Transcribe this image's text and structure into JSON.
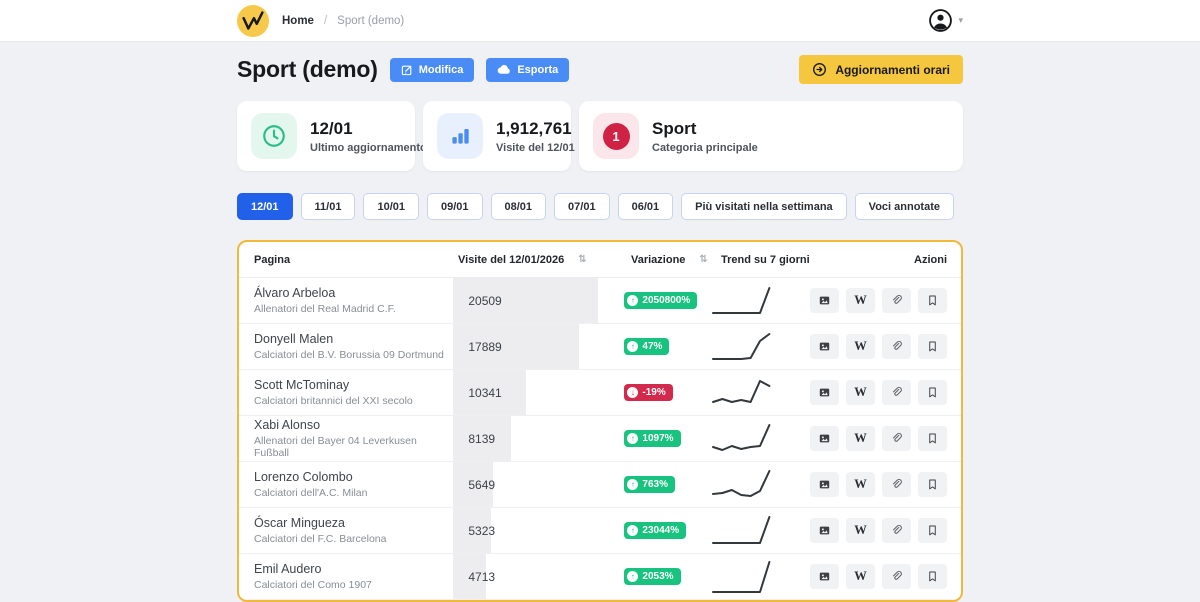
{
  "topbar": {
    "breadcrumb": {
      "home": "Home",
      "separator": "/",
      "current": "Sport (demo)"
    }
  },
  "header": {
    "title": "Sport (demo)",
    "edit_label": "Modifica",
    "export_label": "Esporta",
    "hourly_label": "Aggiornamenti orari"
  },
  "stat_cards": [
    {
      "id": "last-update",
      "value": "12/01",
      "label": "Ultimo aggiornamento",
      "icon": "clock-icon"
    },
    {
      "id": "daily-visits",
      "value": "1,912,761",
      "label": "Visite del 12/01",
      "icon": "bar-chart-icon"
    },
    {
      "id": "main-category",
      "value": "Sport",
      "label": "Categoria principale",
      "icon": "rank-1-badge",
      "badge_text": "1"
    }
  ],
  "filters": {
    "tabs": [
      {
        "label": "12/01",
        "active": true
      },
      {
        "label": "11/01",
        "active": false
      },
      {
        "label": "10/01",
        "active": false
      },
      {
        "label": "09/01",
        "active": false
      },
      {
        "label": "08/01",
        "active": false
      },
      {
        "label": "07/01",
        "active": false
      },
      {
        "label": "06/01",
        "active": false
      },
      {
        "label": "Più visitati nella settimana",
        "active": false
      },
      {
        "label": "Voci annotate",
        "active": false
      }
    ]
  },
  "table": {
    "columns": {
      "page": "Pagina",
      "visits": "Visite del 12/01/2026",
      "variation": "Variazione",
      "trend": "Trend su 7 giorni",
      "actions": "Azioni"
    },
    "sort_icon": "⇅",
    "actions": [
      "image-icon",
      "wikipedia-icon",
      "link-icon",
      "bookmark-icon"
    ],
    "rows": [
      {
        "name": "Álvaro Arbeloa",
        "subtitle": "Allenatori del Real Madrid C.F.",
        "visits": 20509,
        "variation": "2050800%",
        "direction": "up",
        "trend": [
          31,
          31,
          31,
          31,
          31,
          31,
          6
        ]
      },
      {
        "name": "Donyell Malen",
        "subtitle": "Calciatori del B.V. Borussia 09 Dortmund",
        "visits": 17889,
        "variation": "47%",
        "direction": "up",
        "trend": [
          31,
          31,
          31,
          31,
          30,
          13,
          6
        ]
      },
      {
        "name": "Scott McTominay",
        "subtitle": "Calciatori britannici del XXI secolo",
        "visits": 10341,
        "variation": "-19%",
        "direction": "down",
        "trend": [
          28,
          25,
          28,
          26,
          28,
          7,
          12
        ]
      },
      {
        "name": "Xabi Alonso",
        "subtitle": "Allenatori del Bayer 04 Leverkusen Fußball",
        "visits": 8139,
        "variation": "1097%",
        "direction": "up",
        "trend": [
          27,
          30,
          26,
          29,
          27,
          26,
          5
        ]
      },
      {
        "name": "Lorenzo Colombo",
        "subtitle": "Calciatori dell'A.C. Milan",
        "visits": 5649,
        "variation": "763%",
        "direction": "up",
        "trend": [
          28,
          27,
          24,
          29,
          30,
          25,
          5
        ]
      },
      {
        "name": "Óscar Mingueza",
        "subtitle": "Calciatori del F.C. Barcelona",
        "visits": 5323,
        "variation": "23044%",
        "direction": "up",
        "trend": [
          31,
          31,
          31,
          31,
          31,
          31,
          5
        ]
      },
      {
        "name": "Emil Audero",
        "subtitle": "Calciatori del Como 1907",
        "visits": 4713,
        "variation": "2053%",
        "direction": "up",
        "trend": [
          34,
          34,
          34,
          34,
          34,
          34,
          4
        ]
      }
    ]
  },
  "colors": {
    "accent_blue": "#4a8cf5",
    "active_tab_blue": "#2160e8",
    "brand_yellow": "#f4c73f",
    "logo_yellow": "#f6c94a",
    "badge_green": "#17c37e",
    "badge_red": "#d2294d",
    "table_border_amber": "#f0b93a",
    "icon_green": "#2bbd8a",
    "rank_red": "#cf2244"
  }
}
